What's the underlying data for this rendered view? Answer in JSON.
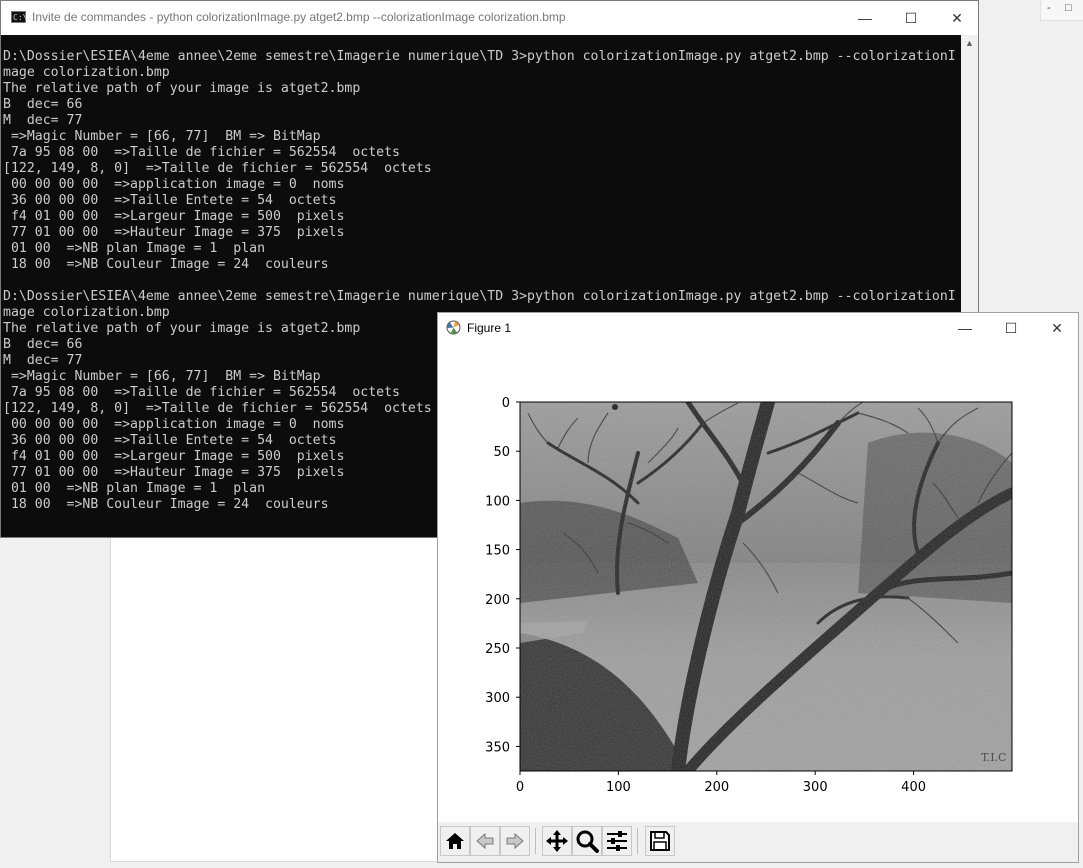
{
  "desktop": {
    "corner_labels": [
      "-",
      "□"
    ]
  },
  "cmd": {
    "title": "Invite de commandes - python  colorizationImage.py atget2.bmp --colorizationImage colorization.bmp",
    "icon_text": "C:\\.",
    "lines": [
      "D:\\Dossier\\ESIEA\\4eme annee\\2eme semestre\\Imagerie numerique\\TD 3>python colorizationImage.py atget2.bmp --colorizationI",
      "mage colorization.bmp",
      "The relative path of your image is atget2.bmp",
      "B  dec= 66",
      "M  dec= 77",
      " =>Magic Number = [66, 77]  BM => BitMap",
      " 7a 95 08 00  =>Taille de fichier = 562554  octets",
      "[122, 149, 8, 0]  =>Taille de fichier = 562554  octets",
      " 00 00 00 00  =>application image = 0  noms",
      " 36 00 00 00  =>Taille Entete = 54  octets",
      " f4 01 00 00  =>Largeur Image = 500  pixels",
      " 77 01 00 00  =>Hauteur Image = 375  pixels",
      " 01 00  =>NB plan Image = 1  plan",
      " 18 00  =>NB Couleur Image = 24  couleurs",
      "",
      "D:\\Dossier\\ESIEA\\4eme annee\\2eme semestre\\Imagerie numerique\\TD 3>python colorizationImage.py atget2.bmp --colorizationI",
      "mage colorization.bmp",
      "The relative path of your image is atget2.bmp",
      "B  dec= 66",
      "M  dec= 77",
      " =>Magic Number = [66, 77]  BM => BitMap",
      " 7a 95 08 00  =>Taille de fichier = 562554  octets",
      "[122, 149, 8, 0]  =>Taille de fichier = 562554  octets",
      " 00 00 00 00  =>application image = 0  noms",
      " 36 00 00 00  =>Taille Entete = 54  octets",
      " f4 01 00 00  =>Largeur Image = 500  pixels",
      " 77 01 00 00  =>Hauteur Image = 375  pixels",
      " 01 00  =>NB plan Image = 1  plan",
      " 18 00  =>NB Couleur Image = 24  couleurs"
    ],
    "controls": {
      "minimize": "—",
      "maximize": "☐",
      "close": "✕"
    },
    "scroll_up": "▲"
  },
  "figure": {
    "title": "Figure 1",
    "controls": {
      "minimize": "—",
      "maximize": "☐",
      "close": "✕"
    },
    "toolbar": [
      {
        "name": "home-button",
        "icon": "home-icon"
      },
      {
        "name": "back-button",
        "icon": "back-arrow-icon"
      },
      {
        "name": "forward-button",
        "icon": "forward-arrow-icon"
      },
      {
        "name": "pan-button",
        "icon": "move-icon"
      },
      {
        "name": "zoom-button",
        "icon": "zoom-icon"
      },
      {
        "name": "configure-subplots-button",
        "icon": "sliders-icon"
      },
      {
        "name": "save-button",
        "icon": "save-icon"
      }
    ]
  },
  "chart_data": {
    "type": "image",
    "image_shape": [
      375,
      500
    ],
    "colormap": "grayscale",
    "xlim": [
      0,
      500
    ],
    "ylim": [
      375,
      0
    ],
    "xticks": [
      0,
      100,
      200,
      300,
      400
    ],
    "yticks": [
      0,
      50,
      100,
      150,
      200,
      250,
      300,
      350
    ],
    "xtick_labels": [
      "0",
      "100",
      "200",
      "300",
      "400"
    ],
    "ytick_labels": [
      "0",
      "50",
      "100",
      "150",
      "200",
      "250",
      "300",
      "350"
    ],
    "image_signature": "T.I.C"
  }
}
